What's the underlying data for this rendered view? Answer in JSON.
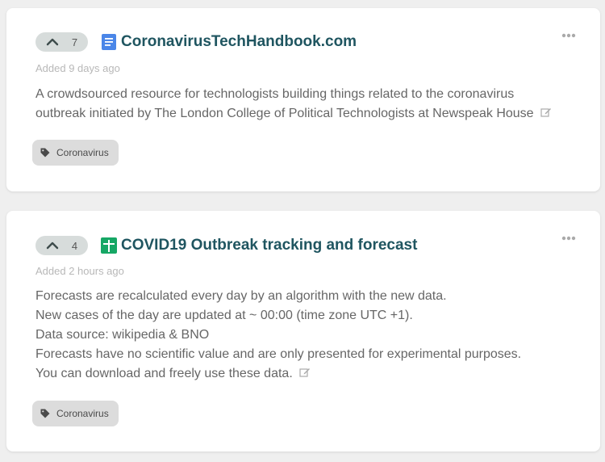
{
  "posts": [
    {
      "votes": "7",
      "type_icon": "document-icon",
      "type_color": "#4a86e8",
      "title": "CoronavirusTechHandbook.com",
      "added": "Added 9 days ago",
      "description_lines": [
        "A crowdsourced resource for technologists building things related to the coronavirus",
        "outbreak initiated by The London College of Political Technologists at Newspeak House"
      ],
      "tag": "Coronavirus"
    },
    {
      "votes": "4",
      "type_icon": "spreadsheet-icon",
      "type_color": "#16a765",
      "title": "COVID19 Outbreak tracking and forecast",
      "added": "Added 2 hours ago",
      "description_lines": [
        "Forecasts are recalculated every day by an algorithm with the new data.",
        "New cases of the day are updated at ~ 00:00 (time zone UTC +1).",
        "Data source: wikipedia & BNO",
        "Forecasts have no scientific value and are only presented for experimental purposes.",
        "You can download and freely use these data."
      ],
      "tag": "Coronavirus"
    }
  ],
  "colors": {
    "title": "#1f5560",
    "vote_bg": "#d7dcdb",
    "tag_bg": "#dcdcdc",
    "page_bg": "#efefef"
  }
}
